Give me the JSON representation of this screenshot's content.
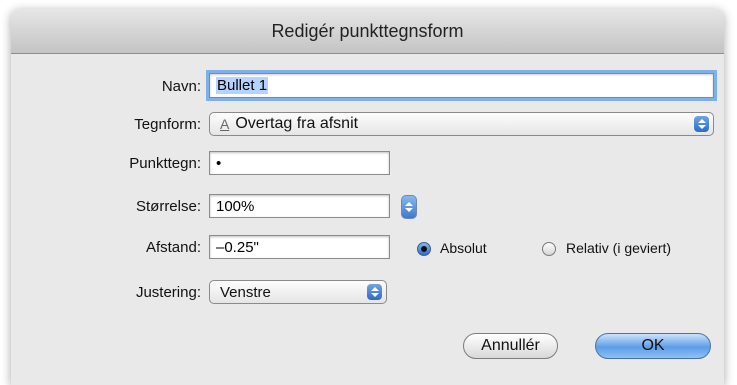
{
  "dialog": {
    "title": "Redigér punkttegnsform",
    "name_label": "Navn:",
    "name_value": "Bullet 1",
    "glyph_form_label": "Tegnform:",
    "glyph_form_icon": "font-glyph-icon",
    "glyph_form_value": "Overtag fra afsnit",
    "bullet_char_label": "Punkttegn:",
    "bullet_char_value": "•",
    "size_label": "Størrelse:",
    "size_value": "100%",
    "distance_label": "Afstand:",
    "distance_value": "–0.25\"",
    "distance_mode_absolute": "Absolut",
    "distance_mode_relative": "Relativ (i geviert)",
    "distance_mode_selected": "Absolut",
    "alignment_label": "Justering:",
    "alignment_value": "Venstre",
    "cancel_label": "Annullér",
    "ok_label": "OK"
  },
  "colors": {
    "accent": "#3d79cf",
    "focus_ring": "#7fb0ea"
  }
}
